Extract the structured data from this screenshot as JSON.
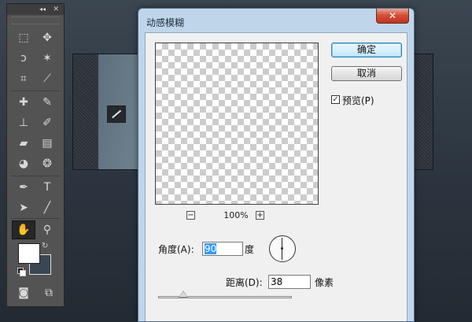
{
  "toolbox": {
    "collapse_glyph": "◂◂",
    "close_glyph": "✕",
    "tools": [
      {
        "name": "marquee-icon",
        "glyph": "⬚"
      },
      {
        "name": "move-icon",
        "glyph": "✥"
      },
      {
        "name": "lasso-icon",
        "glyph": "ↄ"
      },
      {
        "name": "magic-wand-icon",
        "glyph": "✶"
      },
      {
        "name": "crop-icon",
        "glyph": "⌗"
      },
      {
        "name": "eyedropper-icon",
        "glyph": "⟋"
      },
      {
        "name": "healing-brush-icon",
        "glyph": "✚"
      },
      {
        "name": "brush-icon",
        "glyph": "✎"
      },
      {
        "name": "clone-stamp-icon",
        "glyph": "⊥"
      },
      {
        "name": "history-brush-icon",
        "glyph": "✐"
      },
      {
        "name": "eraser-icon",
        "glyph": "▰"
      },
      {
        "name": "gradient-icon",
        "glyph": "▤"
      },
      {
        "name": "blur-icon",
        "glyph": "◕"
      },
      {
        "name": "dodge-icon",
        "glyph": "❂"
      },
      {
        "name": "pen-icon",
        "glyph": "✒"
      },
      {
        "name": "type-icon",
        "glyph": "T"
      },
      {
        "name": "path-selection-icon",
        "glyph": "➤"
      },
      {
        "name": "line-icon",
        "glyph": "╱"
      },
      {
        "name": "hand-icon",
        "glyph": "✋"
      },
      {
        "name": "zoom-icon",
        "glyph": "⚲"
      },
      {
        "name": "quick-mask-icon",
        "glyph": "◙"
      },
      {
        "name": "screen-mode-icon",
        "glyph": "⧉"
      }
    ],
    "swap_glyph": "↻",
    "fg_color": "#ffffff",
    "bg_color": "#3a4653"
  },
  "dialog": {
    "title": "动感模糊",
    "close_glyph": "✕",
    "ok_label": "确定",
    "cancel_label": "取消",
    "preview_checked_glyph": "✓",
    "preview_label": "预览(P)",
    "zoom_out_glyph": "−",
    "zoom_in_glyph": "+",
    "zoom_level": "100%",
    "angle_label": "角度(A):",
    "angle_value": "90",
    "angle_unit": "度",
    "distance_label": "距离(D):",
    "distance_value": "38",
    "distance_unit": "像素",
    "distance_slider_fraction": 0.19
  }
}
